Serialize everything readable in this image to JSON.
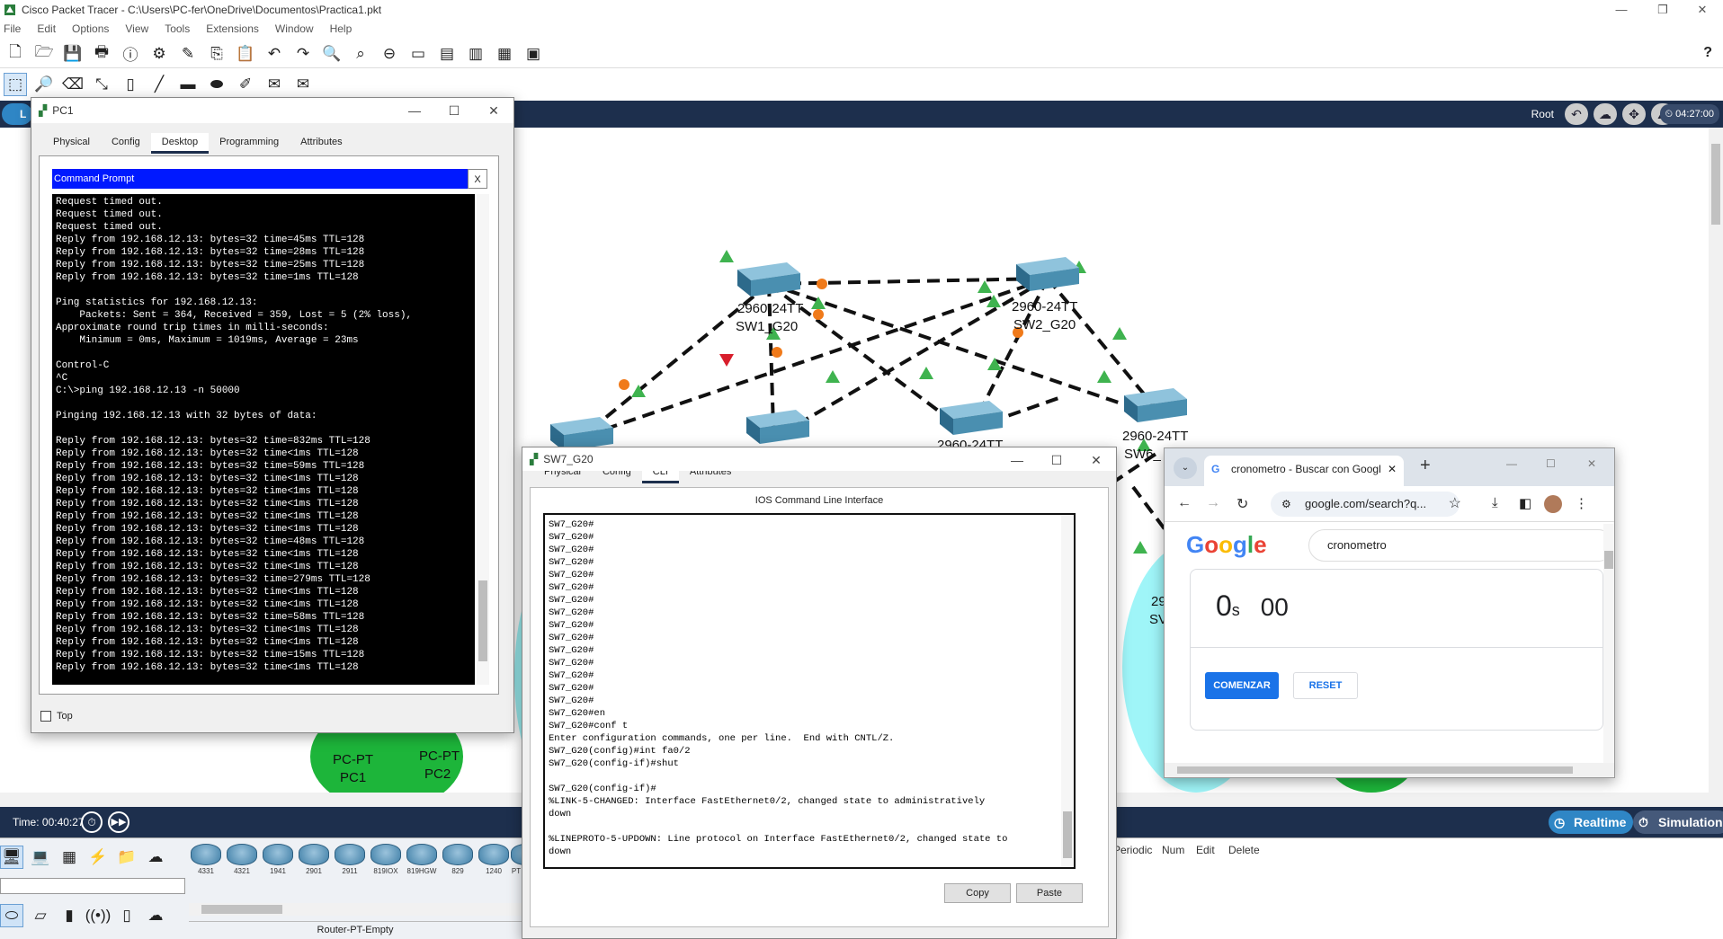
{
  "app": {
    "title": "Cisco Packet Tracer - C:\\Users\\PC-fer\\OneDrive\\Documentos\\Practica1.pkt",
    "menu": [
      "File",
      "Edit",
      "Options",
      "View",
      "Tools",
      "Extensions",
      "Window",
      "Help"
    ],
    "help_label": "?"
  },
  "logical_bar": {
    "root_label": "Root",
    "clock": "04:27:00",
    "tab_letter": "L"
  },
  "bottom_bar": {
    "time_label": "Time: 00:40:27",
    "realtime_label": "Realtime",
    "simulation_label": "Simulation"
  },
  "device_panel": {
    "models": [
      "4331",
      "4321",
      "1941",
      "2901",
      "2911",
      "819IOX",
      "819HGW",
      "829",
      "1240",
      "PT"
    ],
    "selected_label": "Router-PT-Empty"
  },
  "event_panel": {
    "columns": [
      "Periodic",
      "Num",
      "Edit",
      "Delete"
    ]
  },
  "topology": {
    "devices": [
      {
        "model": "2960-24TT",
        "name": "SW1_G20"
      },
      {
        "model": "2960-24TT",
        "name": "SW2_G20"
      },
      {
        "model": "2960-24TT",
        "name": "SW6_"
      },
      {
        "model": "2960-24TT",
        "name": ""
      },
      {
        "model": "29",
        "name": "SV"
      }
    ],
    "pcs": [
      {
        "model": "PC-PT",
        "name": "PC1"
      },
      {
        "model": "PC-PT",
        "name": "PC2"
      }
    ]
  },
  "pc1_window": {
    "title": "PC1",
    "tabs": [
      "Physical",
      "Config",
      "Desktop",
      "Programming",
      "Attributes"
    ],
    "active_tab": "Desktop",
    "cmd_title": "Command Prompt",
    "cmd_close": "X",
    "top_checkbox_label": "Top",
    "lines": [
      "Request timed out.",
      "Request timed out.",
      "Request timed out.",
      "Reply from 192.168.12.13: bytes=32 time=45ms TTL=128",
      "Reply from 192.168.12.13: bytes=32 time=28ms TTL=128",
      "Reply from 192.168.12.13: bytes=32 time=25ms TTL=128",
      "Reply from 192.168.12.13: bytes=32 time=1ms TTL=128",
      "",
      "Ping statistics for 192.168.12.13:",
      "    Packets: Sent = 364, Received = 359, Lost = 5 (2% loss),",
      "Approximate round trip times in milli-seconds:",
      "    Minimum = 0ms, Maximum = 1019ms, Average = 23ms",
      "",
      "Control-C",
      "^C",
      "C:\\>ping 192.168.12.13 -n 50000",
      "",
      "Pinging 192.168.12.13 with 32 bytes of data:",
      "",
      "Reply from 192.168.12.13: bytes=32 time=832ms TTL=128",
      "Reply from 192.168.12.13: bytes=32 time<1ms TTL=128",
      "Reply from 192.168.12.13: bytes=32 time=59ms TTL=128",
      "Reply from 192.168.12.13: bytes=32 time<1ms TTL=128",
      "Reply from 192.168.12.13: bytes=32 time<1ms TTL=128",
      "Reply from 192.168.12.13: bytes=32 time<1ms TTL=128",
      "Reply from 192.168.12.13: bytes=32 time<1ms TTL=128",
      "Reply from 192.168.12.13: bytes=32 time<1ms TTL=128",
      "Reply from 192.168.12.13: bytes=32 time=48ms TTL=128",
      "Reply from 192.168.12.13: bytes=32 time<1ms TTL=128",
      "Reply from 192.168.12.13: bytes=32 time<1ms TTL=128",
      "Reply from 192.168.12.13: bytes=32 time=279ms TTL=128",
      "Reply from 192.168.12.13: bytes=32 time<1ms TTL=128",
      "Reply from 192.168.12.13: bytes=32 time<1ms TTL=128",
      "Reply from 192.168.12.13: bytes=32 time=58ms TTL=128",
      "Reply from 192.168.12.13: bytes=32 time<1ms TTL=128",
      "Reply from 192.168.12.13: bytes=32 time<1ms TTL=128",
      "Reply from 192.168.12.13: bytes=32 time=15ms TTL=128",
      "Reply from 192.168.12.13: bytes=32 time<1ms TTL=128"
    ]
  },
  "sw7_window": {
    "title": "SW7_G20",
    "tabs": [
      "Physical",
      "Config",
      "CLI",
      "Attributes"
    ],
    "active_tab": "CLI",
    "cli_heading": "IOS Command Line Interface",
    "copy_label": "Copy",
    "paste_label": "Paste",
    "lines": [
      "SW7_G20#",
      "SW7_G20#",
      "SW7_G20#",
      "SW7_G20#",
      "SW7_G20#",
      "SW7_G20#",
      "SW7_G20#",
      "SW7_G20#",
      "SW7_G20#",
      "SW7_G20#",
      "SW7_G20#",
      "SW7_G20#",
      "SW7_G20#",
      "SW7_G20#",
      "SW7_G20#",
      "SW7_G20#en",
      "SW7_G20#conf t",
      "Enter configuration commands, one per line.  End with CNTL/Z.",
      "SW7_G20(config)#int fa0/2",
      "SW7_G20(config-if)#shut",
      "",
      "SW7_G20(config-if)#",
      "%LINK-5-CHANGED: Interface FastEthernet0/2, changed state to administratively",
      "down",
      "",
      "%LINEPROTO-5-UPDOWN: Line protocol on Interface FastEthernet0/2, changed state to",
      "down"
    ]
  },
  "chrome_window": {
    "tab_title": "cronometro - Buscar con Googl",
    "url": "google.com/search?q...",
    "search_query": "cronometro",
    "timer_seconds": "0",
    "timer_unit": "s",
    "timer_fraction": "00",
    "start_label": "COMENZAR",
    "reset_label": "RESET"
  },
  "colors": {
    "nav_bar": "#1d2f4d",
    "switch": "#4a8fb0",
    "link_up": "#3fb34f",
    "link_pending": "#f07a1a",
    "pc_area": "#1db53a",
    "zone_cyan": "#9ff5f8",
    "google_blue": "#1a73e8"
  }
}
